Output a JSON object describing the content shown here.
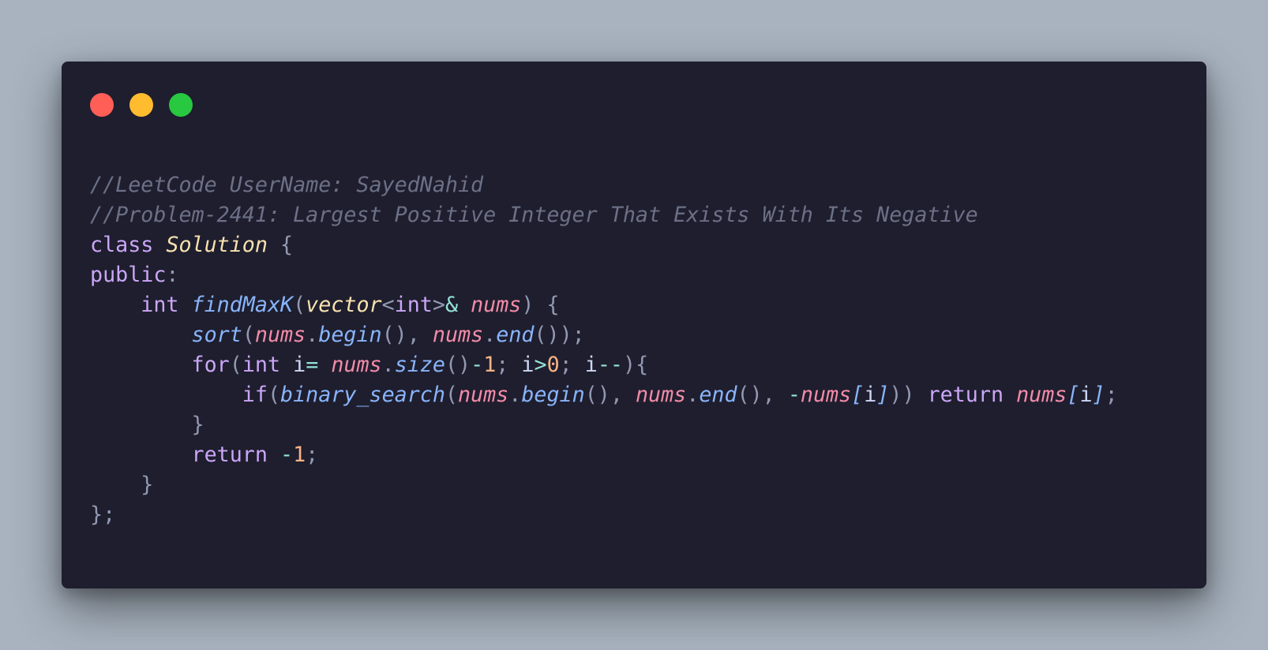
{
  "window": {
    "controls": [
      {
        "name": "close",
        "color": "#ff5f57"
      },
      {
        "name": "minimize",
        "color": "#febc2e"
      },
      {
        "name": "maximize",
        "color": "#28c840"
      }
    ]
  },
  "theme": {
    "background": "#1e1e2e",
    "comment": "#6c7086",
    "keyword": "#cba6f7",
    "class_name": "#f9e2af",
    "function": "#89b4fa",
    "variable": "#f38ba8",
    "number": "#fab387",
    "operator": "#94e2d5",
    "punct": "#9399b2",
    "text": "#cdd6f4"
  },
  "code_lines": [
    [
      {
        "t": "//LeetCode UserName: SayedNahid",
        "c": "comment",
        "i": true
      }
    ],
    [
      {
        "t": "//Problem-2441: Largest Positive Integer That Exists With Its Negative",
        "c": "comment",
        "i": true
      }
    ],
    [
      {
        "t": "class ",
        "c": "keyword"
      },
      {
        "t": "Solution",
        "c": "class_name",
        "i": true
      },
      {
        "t": " {",
        "c": "punct"
      }
    ],
    [
      {
        "t": "public",
        "c": "keyword"
      },
      {
        "t": ":",
        "c": "punct"
      }
    ],
    [
      {
        "t": "    int ",
        "c": "keyword"
      },
      {
        "t": "findMaxK",
        "c": "function",
        "i": true
      },
      {
        "t": "(",
        "c": "punct"
      },
      {
        "t": "vector",
        "c": "class_name",
        "i": true
      },
      {
        "t": "<",
        "c": "punct"
      },
      {
        "t": "int",
        "c": "keyword"
      },
      {
        "t": ">",
        "c": "punct"
      },
      {
        "t": "& ",
        "c": "operator"
      },
      {
        "t": "nums",
        "c": "variable",
        "i": true
      },
      {
        "t": ") {",
        "c": "punct"
      }
    ],
    [
      {
        "t": "        ",
        "c": "text"
      },
      {
        "t": "sort",
        "c": "function",
        "i": true
      },
      {
        "t": "(",
        "c": "punct"
      },
      {
        "t": "nums",
        "c": "variable",
        "i": true
      },
      {
        "t": ".",
        "c": "punct"
      },
      {
        "t": "begin",
        "c": "function",
        "i": true
      },
      {
        "t": "(), ",
        "c": "punct"
      },
      {
        "t": "nums",
        "c": "variable",
        "i": true
      },
      {
        "t": ".",
        "c": "punct"
      },
      {
        "t": "end",
        "c": "function",
        "i": true
      },
      {
        "t": "());",
        "c": "punct"
      }
    ],
    [
      {
        "t": "        for",
        "c": "keyword"
      },
      {
        "t": "(",
        "c": "punct"
      },
      {
        "t": "int ",
        "c": "keyword"
      },
      {
        "t": "i",
        "c": "text"
      },
      {
        "t": "= ",
        "c": "operator"
      },
      {
        "t": "nums",
        "c": "variable",
        "i": true
      },
      {
        "t": ".",
        "c": "punct"
      },
      {
        "t": "size",
        "c": "function",
        "i": true
      },
      {
        "t": "()",
        "c": "punct"
      },
      {
        "t": "-",
        "c": "operator"
      },
      {
        "t": "1",
        "c": "number"
      },
      {
        "t": "; ",
        "c": "punct"
      },
      {
        "t": "i",
        "c": "text"
      },
      {
        "t": ">",
        "c": "operator"
      },
      {
        "t": "0",
        "c": "number"
      },
      {
        "t": "; ",
        "c": "punct"
      },
      {
        "t": "i",
        "c": "text"
      },
      {
        "t": "--",
        "c": "operator"
      },
      {
        "t": "){",
        "c": "punct"
      }
    ],
    [
      {
        "t": "            if",
        "c": "keyword"
      },
      {
        "t": "(",
        "c": "punct"
      },
      {
        "t": "binary_search",
        "c": "function",
        "i": true
      },
      {
        "t": "(",
        "c": "punct"
      },
      {
        "t": "nums",
        "c": "variable",
        "i": true
      },
      {
        "t": ".",
        "c": "punct"
      },
      {
        "t": "begin",
        "c": "function",
        "i": true
      },
      {
        "t": "(), ",
        "c": "punct"
      },
      {
        "t": "nums",
        "c": "variable",
        "i": true
      },
      {
        "t": ".",
        "c": "punct"
      },
      {
        "t": "end",
        "c": "function",
        "i": true
      },
      {
        "t": "(), ",
        "c": "punct"
      },
      {
        "t": "-",
        "c": "operator"
      },
      {
        "t": "nums",
        "c": "variable",
        "i": true
      },
      {
        "t": "[",
        "c": "function",
        "i": true
      },
      {
        "t": "i",
        "c": "text"
      },
      {
        "t": "]",
        "c": "function",
        "i": true
      },
      {
        "t": ")) ",
        "c": "punct"
      },
      {
        "t": "return ",
        "c": "keyword"
      },
      {
        "t": "nums",
        "c": "variable",
        "i": true
      },
      {
        "t": "[",
        "c": "function",
        "i": true
      },
      {
        "t": "i",
        "c": "text"
      },
      {
        "t": "]",
        "c": "function",
        "i": true
      },
      {
        "t": ";",
        "c": "punct"
      }
    ],
    [
      {
        "t": "        }",
        "c": "punct"
      }
    ],
    [
      {
        "t": "        return ",
        "c": "keyword"
      },
      {
        "t": "-",
        "c": "operator"
      },
      {
        "t": "1",
        "c": "number"
      },
      {
        "t": ";",
        "c": "punct"
      }
    ],
    [
      {
        "t": "    }",
        "c": "punct"
      }
    ],
    [
      {
        "t": "};",
        "c": "punct"
      }
    ]
  ]
}
